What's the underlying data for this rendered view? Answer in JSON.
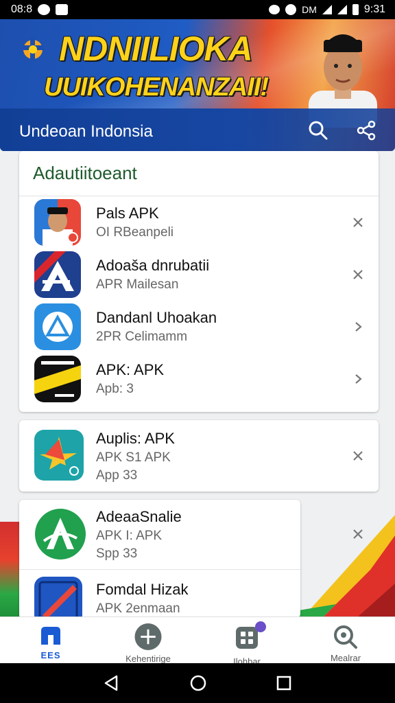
{
  "status_bar": {
    "time_left": "08:8",
    "carrier": "DM",
    "time_right": "9:31"
  },
  "header": {
    "headline_1": "NDNIILIOKA",
    "headline_2": "UUIKOHENANZAII!",
    "title": "Undeoan Indonsia",
    "colors": {
      "primary": "#1747a3",
      "accent": "#ffd21a"
    }
  },
  "cards": [
    {
      "header": "Adautiitoeant",
      "items": [
        {
          "name": "Pals APK",
          "sub": "OI RBeanpeli",
          "action": "close-icon"
        },
        {
          "name": "Adoaša dnrubatii",
          "sub": "APR Mailesan",
          "action": "close-icon"
        },
        {
          "name": "Dandanl Uhoakan",
          "sub": "2PR Celimamm",
          "action": "chevron-right-icon"
        },
        {
          "name": "APK: APK",
          "sub": "Apb: 3",
          "action": "chevron-right-icon"
        }
      ]
    },
    {
      "items": [
        {
          "name": "Auplis: APK",
          "sub": "APK S1 APK",
          "sub2": "App 33",
          "action": "close-icon"
        }
      ]
    },
    {
      "items": [
        {
          "name": "AdeaaSnalie",
          "sub": "APK I: APK",
          "sub2": "Spp 33",
          "action": "close-icon"
        },
        {
          "name": "Fomdal Hizak",
          "sub": "APK 2enmaan"
        }
      ]
    }
  ],
  "bottom_nav": [
    {
      "label": "",
      "icon": "home-icon",
      "active": true
    },
    {
      "label": "Kehentirige",
      "icon": "plus-circle-icon"
    },
    {
      "label": "Ilohbar",
      "icon": "grid-icon",
      "badge": true
    },
    {
      "label": "Mealrar",
      "icon": "search-icon"
    }
  ],
  "home_nav_caption": "EES"
}
